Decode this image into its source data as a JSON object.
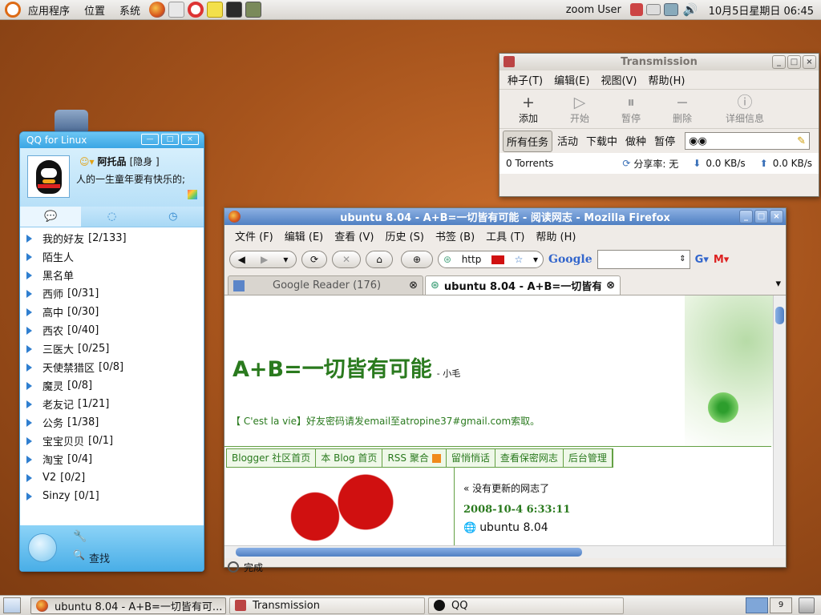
{
  "top_panel": {
    "menus": [
      "应用程序",
      "位置",
      "系统"
    ],
    "user": "zoom User",
    "datetime": "10月5日星期日  06:45"
  },
  "qq": {
    "title": "QQ for Linux",
    "nickname": "阿托品",
    "status": "[隐身 ]",
    "signature": "人的一生童年要有快乐的;",
    "groups": [
      {
        "name": "我的好友",
        "count": "[2/133]"
      },
      {
        "name": "陌生人",
        "count": ""
      },
      {
        "name": "黑名单",
        "count": ""
      },
      {
        "name": "西师",
        "count": "[0/31]"
      },
      {
        "name": "高中",
        "count": "[0/30]"
      },
      {
        "name": "西农",
        "count": "[0/40]"
      },
      {
        "name": "三医大",
        "count": "[0/25]"
      },
      {
        "name": "天使禁猎区",
        "count": "[0/8]"
      },
      {
        "name": "魔灵",
        "count": "[0/8]"
      },
      {
        "name": "老友记",
        "count": "[1/21]"
      },
      {
        "name": "公务",
        "count": "[1/38]"
      },
      {
        "name": "宝宝贝贝",
        "count": "[0/1]"
      },
      {
        "name": "淘宝",
        "count": "[0/4]"
      },
      {
        "name": "V2",
        "count": "[0/2]"
      },
      {
        "name": "Sinzy",
        "count": "[0/1]"
      }
    ],
    "find_label": "查找"
  },
  "transmission": {
    "title": "Transmission",
    "menus": [
      "种子(T)",
      "编辑(E)",
      "视图(V)",
      "帮助(H)"
    ],
    "toolbar": [
      {
        "glyph": "+",
        "label": "添加",
        "enabled": true
      },
      {
        "glyph": "▷",
        "label": "开始",
        "enabled": false
      },
      {
        "glyph": "⏸",
        "label": "暂停",
        "enabled": false
      },
      {
        "glyph": "−",
        "label": "删除",
        "enabled": false
      },
      {
        "glyph": "ⓘ",
        "label": "详细信息",
        "enabled": false
      }
    ],
    "filters": [
      "所有任务",
      "活动",
      "下载中",
      "做种",
      "暂停"
    ],
    "status": {
      "torrents": "0 Torrents",
      "ratio": "分享率: 无",
      "down": "0.0 KB/s",
      "up": "0.0 KB/s"
    }
  },
  "firefox": {
    "title": "ubuntu 8.04 - A+B=一切皆有可能 - 阅读网志 - Mozilla Firefox",
    "menus": [
      "文件 (F)",
      "编辑 (E)",
      "查看 (V)",
      "历史 (S)",
      "书签 (B)",
      "工具 (T)",
      "帮助 (H)"
    ],
    "url": "http",
    "search_engine": "Google",
    "tabs": [
      {
        "label": "Google Reader (176)"
      },
      {
        "label": "ubuntu 8.04 - A+B=一切皆有..."
      }
    ],
    "page": {
      "blog_title": "A+B=一切皆有可能",
      "author": "- 小毛",
      "notice": "【 C'est la vie】好友密码请发email至atropine37#gmail.com索取。",
      "links": [
        "Blogger 社区首页",
        "本 Blog 首页",
        "RSS 聚合",
        "留悄悄话",
        "查看保密网志",
        "后台管理"
      ],
      "no_update": "« 没有更新的网志了",
      "post_date": "2008-10-4 6:33:11",
      "post_title": "ubuntu 8.04"
    },
    "status_text": "完成"
  },
  "taskbar": {
    "items": [
      "ubuntu 8.04 - A+B=一切皆有可...",
      "Transmission",
      "QQ"
    ],
    "workspace": "9"
  },
  "colors": {
    "accent": "#4f7fc2",
    "qq_blue": "#58b8ec",
    "blog_green": "#2a7a1e",
    "red": "#d01010"
  }
}
